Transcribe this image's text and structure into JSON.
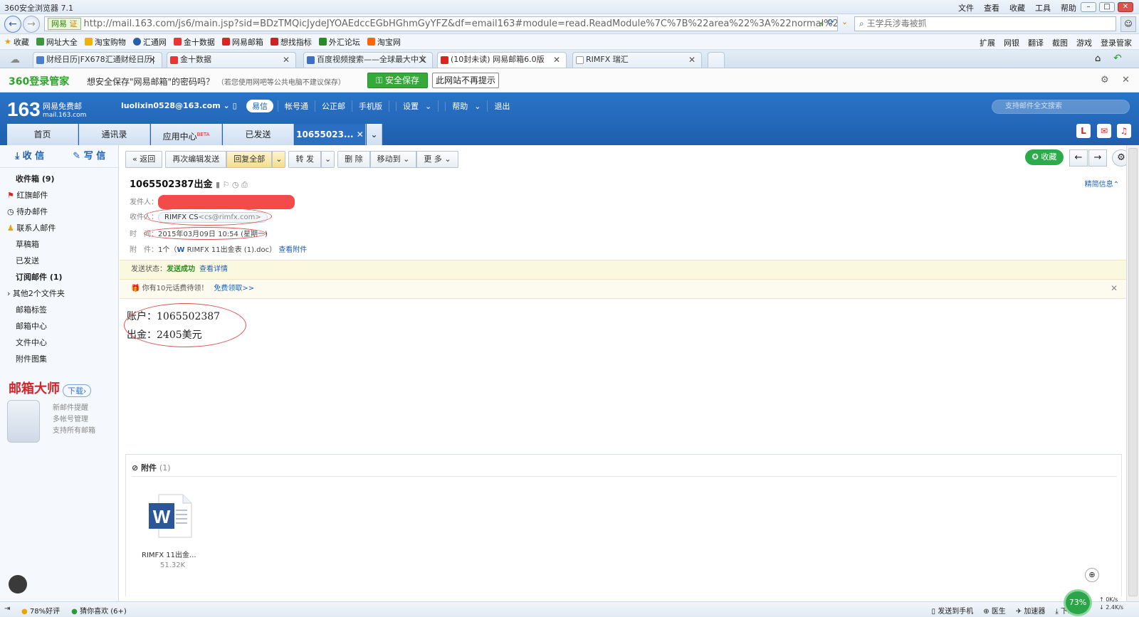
{
  "browser": {
    "title": "360安全浏览器 7.1",
    "menu": [
      "文件",
      "查看",
      "收藏",
      "工具",
      "帮助"
    ],
    "url_badge": "网易",
    "url_badge2": "证",
    "url": "http://mail.163.com/js6/main.jsp?sid=BDzTMQicJydeJYOAEdccEGbHGhmGyYFZ&df=email163#module=read.ReadModule%7C%7B%22area%22%3A%22normal%22",
    "search_text": "王学兵涉毒被抓",
    "bookmarks": [
      "收藏",
      "网址大全",
      "淘宝购物",
      "汇通网",
      "金十数据",
      "网易邮箱",
      "想找指标",
      "外汇论坛",
      "淘宝网"
    ],
    "bookmarks_right": [
      "扩展",
      "网银",
      "翻译",
      "截图",
      "游戏",
      "登录管家"
    ],
    "tabs": [
      {
        "label": "财经日历|FX678汇通财经日历|",
        "color": "#4a7fd0"
      },
      {
        "label": "金十数据",
        "color": "#e33"
      },
      {
        "label": "百度视频搜索——全球最大中文",
        "color": "#3b6fc9"
      },
      {
        "label": "(10封未读) 网易邮箱6.0版",
        "color": "#d22"
      },
      {
        "label": "RIMFX 瑞汇",
        "color": "#999"
      }
    ]
  },
  "savebar": {
    "logo": "360登录管家",
    "message": "想安全保存\"网易邮箱\"的密码吗？",
    "hint": "（若您使用网吧等公共电脑不建议保存）",
    "save_button": "安全保存",
    "no_prompt_button": "此网站不再提示"
  },
  "mail": {
    "logo_num": "163",
    "logo_name": "网易免费邮",
    "logo_domain": "mail.163.com",
    "account": "luolixin0528@163.com",
    "yixin": "易信",
    "header_links": [
      "帐号通",
      "公正邮",
      "手机版",
      "设置",
      "帮助",
      "退出"
    ],
    "search_placeholder": "支持邮件全文搜索",
    "nav_tabs": [
      "首页",
      "通讯录",
      "应用中心",
      "已发送",
      "10655023..."
    ],
    "beta": "BETA"
  },
  "sidebar": {
    "receive": "收 信",
    "compose": "写 信",
    "folders": [
      {
        "label": "收件箱 (9)",
        "bold": true
      },
      {
        "label": "红旗邮件",
        "bold": false
      },
      {
        "label": "待办邮件",
        "bold": false
      },
      {
        "label": "联系人邮件",
        "bold": false
      },
      {
        "label": "草稿箱",
        "bold": false
      },
      {
        "label": "已发送",
        "bold": false
      },
      {
        "label": "订阅邮件 (1)",
        "bold": true
      },
      {
        "label": "其他2个文件夹",
        "bold": false
      },
      {
        "label": "邮箱标签",
        "bold": false
      },
      {
        "label": "邮箱中心",
        "bold": false
      },
      {
        "label": "文件中心",
        "bold": false
      },
      {
        "label": "附件图集",
        "bold": false
      }
    ],
    "promo_title": "邮箱大师",
    "promo_download": "下载",
    "promo_features": [
      "新邮件提醒",
      "多帐号管理",
      "支持所有邮箱"
    ]
  },
  "toolbar": {
    "back": "返回",
    "edit_resend": "再次编辑发送",
    "reply_all": "回复全部",
    "forward": "转 发",
    "delete": "删 除",
    "move_to": "移动到",
    "more": "更 多",
    "star": "收藏"
  },
  "message": {
    "subject": "1065502387出金",
    "detail_info": "精简信息",
    "from_label": "发件人：",
    "to_label": "收件人：",
    "to_name": "RIMFX CS",
    "to_email": "<cs@rimfx.com>",
    "time_label": "时　间：",
    "time_value": "2015年03月09日 10:54 (星期一)",
    "attach_label": "附　件：",
    "attach_count": "1个",
    "attach_name": "RIMFX 11出金表 (1).doc",
    "view_attach": "查看附件",
    "send_status_label": "发送状态：",
    "send_status": "发送成功",
    "view_detail": "查看详情",
    "ad_text": "你有10元话费待领！",
    "ad_link": "免费领取>>",
    "body_line1": "账户：1065502387",
    "body_line2": "出金：2405美元",
    "attachments_header": "附件",
    "attachments_count": "(1)",
    "attachment_short_name": "RIMFX 11出金...",
    "attachment_size": "51.32K"
  },
  "statusbar": {
    "left": [
      "78%好评",
      "猜你喜欢 (6+)"
    ],
    "right": [
      "发送到手机",
      "医生",
      "加速器",
      "下载"
    ],
    "gauge": "73%",
    "speed_up": "0K/s",
    "speed_down": "2.4K/s"
  }
}
